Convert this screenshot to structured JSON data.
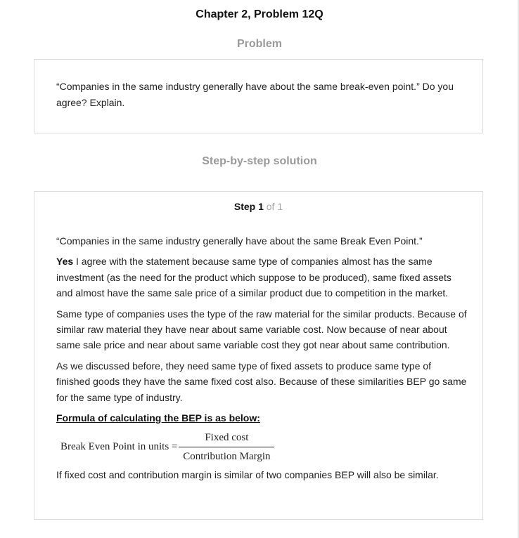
{
  "title": "Chapter 2, Problem 12Q",
  "problem_heading": "Problem",
  "problem_text": "“Companies in the same industry generally have about the same break-even point.” Do you agree? Explain.",
  "solution_heading": "Step-by-step solution",
  "step": {
    "word": "Step 1",
    "of": "of 1"
  },
  "solution": {
    "quote": "“Companies in the same industry generally have about the same Break Even Point.”",
    "yes_word": "Yes",
    "para1_rest": " I agree with the statement because same type of companies almost has the same investment (as the need for the product which suppose to be produced), same fixed assets and almost have the same sale price of a similar product due to competition in the market.",
    "para2": "Same type of companies uses the type of the raw material for the similar products. Because of similar raw material they have near about same variable cost. Now because of near about same sale price and near about same variable cost they got near about same contribution.",
    "para3": "As we discussed before, they need same type of fixed assets to produce same type of finished goods they have the same fixed cost also. Because of these similarities BEP go same for the same type of industry.",
    "formula_heading": "Formula of calculating the BEP is as below:",
    "formula": {
      "lhs": "Break Even Point in units =",
      "numerator": "Fixed cost",
      "denominator": "Contribution Margin"
    },
    "conclusion": "If fixed cost and contribution margin is similar of two companies BEP will also be similar."
  }
}
